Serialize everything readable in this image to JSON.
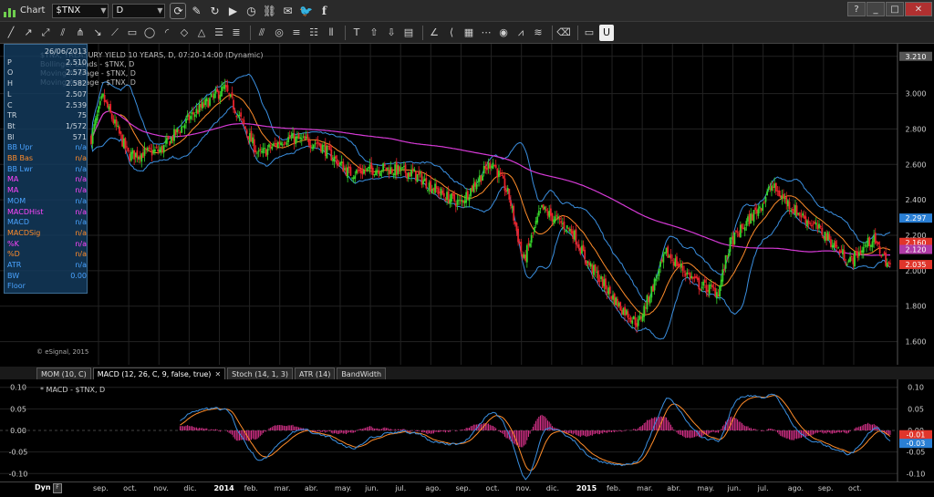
{
  "window": {
    "title": "Chart",
    "symbol": "$TNX",
    "interval": "D",
    "buttons": {
      "minimize": "_",
      "maximize": "□",
      "close": "✕",
      "help": "?"
    }
  },
  "toolbar": {
    "icons": [
      "trendline-icon",
      "ray-icon",
      "extended-line-icon",
      "channel-icon",
      "pitchfork-icon",
      "arrow-icon",
      "line-icon",
      "rectangle-icon",
      "ellipse-icon",
      "arc-icon",
      "polygon-icon",
      "triangle-icon",
      "fib-retracement-icon",
      "fib-extension-icon",
      "parallel-lines-icon",
      "circles-icon",
      "hline-icon",
      "grid-icon",
      "vertical-lines-icon",
      "text-icon",
      "up-arrow-icon",
      "down-arrow-icon",
      "ruler-icon",
      "angle-icon",
      "fan-icon",
      "fib-grid-icon",
      "cycles-icon",
      "eye-icon",
      "zigzag-icon",
      "lines-icon",
      "eraser-icon",
      "comment-icon",
      "magnet-icon"
    ]
  },
  "main": {
    "legend": [
      "$TNX, TREASURY YIELD 10 YEARS, D, 07:20-14:00 (Dynamic)",
      "Bollinger Bands - $TNX, D",
      "Moving Average - $TNX, D",
      "Moving Average - $TNX, D"
    ],
    "watermark": "© eSignal, 2015",
    "price_badge": "3.210",
    "y_labels": [
      "3.210",
      "3.000",
      "2.800",
      "2.600",
      "2.400",
      "2.200",
      "2.000",
      "1.800",
      "1.600"
    ],
    "right_badges": [
      {
        "text": "3.210",
        "color": "#555555"
      },
      {
        "text": "2.297",
        "color": "#2a7fd4"
      },
      {
        "text": "2.160",
        "color": "#e0352b"
      },
      {
        "text": "2.120",
        "color": "#b03aa6"
      },
      {
        "text": "2.035",
        "color": "#e0352b"
      }
    ]
  },
  "datapanel": {
    "rows": [
      {
        "label": "",
        "value": "26/06/2013",
        "color": "#cfd8e0"
      },
      {
        "label": "P",
        "value": "2.510",
        "color": "#cfd8e0"
      },
      {
        "label": "O",
        "value": "2.573",
        "color": "#cfd8e0"
      },
      {
        "label": "H",
        "value": "2.582",
        "color": "#cfd8e0"
      },
      {
        "label": "L",
        "value": "2.507",
        "color": "#cfd8e0"
      },
      {
        "label": "C",
        "value": "2.539",
        "color": "#cfd8e0"
      },
      {
        "label": "TR",
        "value": "75",
        "color": "#cfd8e0"
      },
      {
        "label": "Bt",
        "value": "1/572",
        "color": "#cfd8e0"
      },
      {
        "label": "Bl",
        "value": "571",
        "color": "#cfd8e0"
      },
      {
        "label": "BB Upr",
        "value": "n/a",
        "color": "#4aa3ff"
      },
      {
        "label": "BB Bas",
        "value": "n/a",
        "color": "#ff8c2a"
      },
      {
        "label": "BB Lwr",
        "value": "n/a",
        "color": "#4aa3ff"
      },
      {
        "label": "MA",
        "value": "n/a",
        "color": "#ff45ff"
      },
      {
        "label": "MA",
        "value": "n/a",
        "color": "#ff45ff"
      },
      {
        "label": "MOM",
        "value": "n/a",
        "color": "#4aa3ff"
      },
      {
        "label": "MACDHist",
        "value": "n/a",
        "color": "#ff45ff"
      },
      {
        "label": "MACD",
        "value": "n/a",
        "color": "#4aa3ff"
      },
      {
        "label": "MACDSig",
        "value": "n/a",
        "color": "#ff8c2a"
      },
      {
        "label": "%K",
        "value": "n/a",
        "color": "#ff45ff"
      },
      {
        "label": "%D",
        "value": "n/a",
        "color": "#ff8c2a"
      },
      {
        "label": "ATR",
        "value": "n/a",
        "color": "#4aa3ff"
      },
      {
        "label": "BW",
        "value": "0.00",
        "color": "#4aa3ff"
      },
      {
        "label": "Floor",
        "value": "",
        "color": "#4aa3ff"
      }
    ]
  },
  "tabs": [
    {
      "label": "MOM (10, C)",
      "active": false
    },
    {
      "label": "MACD (12, 26, C, 9, false, true)",
      "active": true
    },
    {
      "label": "Stoch (14, 1, 3)",
      "active": false
    },
    {
      "label": "ATR (14)",
      "active": false
    },
    {
      "label": "BandWidth",
      "active": false
    }
  ],
  "macd": {
    "legend": "* MACD - $TNX, D",
    "y_labels": [
      "0.10",
      "0.05",
      "0.00",
      "-0.05",
      "-0.10"
    ],
    "right_badges": [
      {
        "text": "-0.01",
        "color": "#e0352b"
      },
      {
        "text": "-0.03",
        "color": "#2a7fd4"
      }
    ]
  },
  "xaxis": {
    "dyn": "Dyn",
    "labels": [
      {
        "text": "sep.",
        "bold": false
      },
      {
        "text": "oct.",
        "bold": false
      },
      {
        "text": "nov.",
        "bold": false
      },
      {
        "text": "dic.",
        "bold": false
      },
      {
        "text": "2014",
        "bold": true
      },
      {
        "text": "feb.",
        "bold": false
      },
      {
        "text": "mar.",
        "bold": false
      },
      {
        "text": "abr.",
        "bold": false
      },
      {
        "text": "may.",
        "bold": false
      },
      {
        "text": "jun.",
        "bold": false
      },
      {
        "text": "jul.",
        "bold": false
      },
      {
        "text": "ago.",
        "bold": false
      },
      {
        "text": "sep.",
        "bold": false
      },
      {
        "text": "oct.",
        "bold": false
      },
      {
        "text": "nov.",
        "bold": false
      },
      {
        "text": "dic.",
        "bold": false
      },
      {
        "text": "2015",
        "bold": true
      },
      {
        "text": "feb.",
        "bold": false
      },
      {
        "text": "mar.",
        "bold": false
      },
      {
        "text": "abr.",
        "bold": false
      },
      {
        "text": "may.",
        "bold": false
      },
      {
        "text": "jun.",
        "bold": false
      },
      {
        "text": "jul.",
        "bold": false
      },
      {
        "text": "ago.",
        "bold": false
      },
      {
        "text": "sep.",
        "bold": false
      },
      {
        "text": "oct.",
        "bold": false
      }
    ]
  },
  "colors": {
    "up": "#36d42a",
    "down": "#e8232b",
    "bb": "#3a8fe0",
    "bbmid": "#ff8c2a",
    "ma": "#d63ad6",
    "macd": "#3a8fe0",
    "signal": "#ff8c2a",
    "hist": "#e0338f",
    "grid": "#222222"
  },
  "chart_data": [
    {
      "type": "candlestick",
      "title": "$TNX, TREASURY YIELD 10 YEARS, D",
      "ylim": [
        1.5,
        3.25
      ],
      "series": [
        {
          "name": "price_path",
          "x": [
            "2013-08-26",
            "2013-09-06",
            "2013-10-01",
            "2013-11-01",
            "2013-12-01",
            "2014-01-01",
            "2014-02-03",
            "2014-03-01",
            "2014-04-01",
            "2014-05-01",
            "2014-06-01",
            "2014-07-01",
            "2014-08-01",
            "2014-08-15",
            "2014-09-15",
            "2014-10-01",
            "2014-10-15",
            "2014-11-01",
            "2014-12-01",
            "2014-12-15",
            "2015-01-15",
            "2015-02-02",
            "2015-03-01",
            "2015-04-01",
            "2015-04-20",
            "2015-05-01",
            "2015-06-01",
            "2015-06-10",
            "2015-07-01",
            "2015-08-01",
            "2015-08-24",
            "2015-09-15",
            "2015-10-02"
          ],
          "values": [
            2.75,
            2.98,
            2.65,
            2.68,
            2.88,
            3.03,
            2.65,
            2.75,
            2.72,
            2.55,
            2.58,
            2.55,
            2.42,
            2.38,
            2.62,
            2.42,
            2.05,
            2.35,
            2.22,
            2.05,
            1.8,
            1.7,
            2.1,
            1.92,
            1.88,
            2.15,
            2.38,
            2.48,
            2.35,
            2.2,
            2.05,
            2.18,
            2.02
          ]
        }
      ]
    }
  ]
}
